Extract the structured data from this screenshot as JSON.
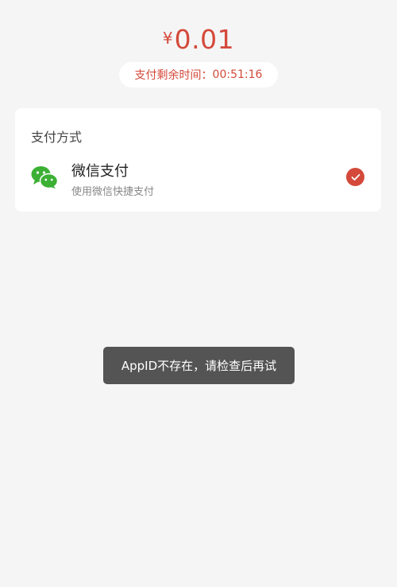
{
  "payment": {
    "currency_symbol": "¥",
    "amount": "0.01",
    "timer_label": "支付剩余时间：",
    "timer_value": "00:51:16"
  },
  "methods_card": {
    "title": "支付方式",
    "items": [
      {
        "name": "微信支付",
        "description": "使用微信快捷支付",
        "icon": "wechat-icon",
        "selected": true
      }
    ]
  },
  "toast": {
    "message": "AppID不存在，请检查后再试"
  },
  "colors": {
    "accent": "#d4493a",
    "wechat_green": "#3cb034",
    "background": "#f5f5f5",
    "toast_bg": "#545454"
  }
}
